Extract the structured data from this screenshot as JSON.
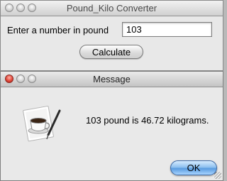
{
  "main_window": {
    "title": "Pound_Kilo Converter",
    "input_label": "Enter a number in pound",
    "input_value": "103",
    "calculate_label": "Calculate"
  },
  "message_dialog": {
    "title": "Message",
    "message": "103 pound is 46.72 kilograms.",
    "ok_label": "OK",
    "icon": "coffee-cup-app-icon"
  },
  "colors": {
    "close_button": "#e2483b",
    "ok_button": "#5a9ce0"
  }
}
